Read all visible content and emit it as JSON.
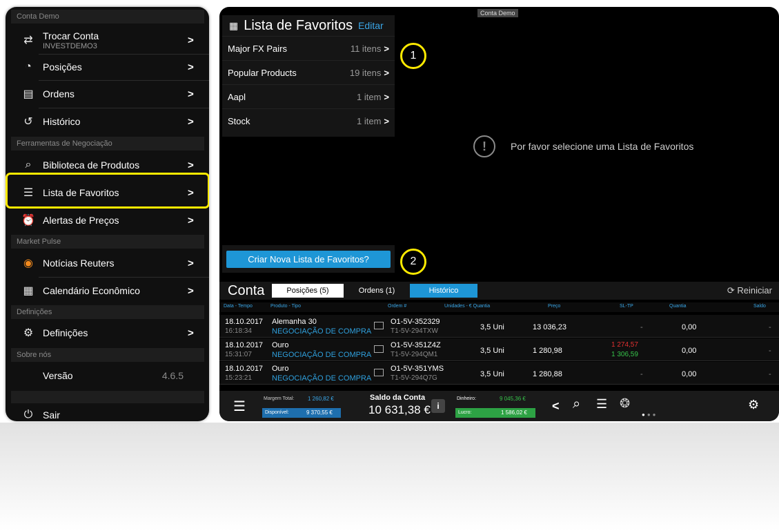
{
  "phone": {
    "sections": {
      "demo": "Conta Demo",
      "tools": "Ferramentas de Negociação",
      "pulse": "Market Pulse",
      "settings": "Definições",
      "about": "Sobre nós"
    },
    "items": {
      "switch_account": "Trocar Conta",
      "account_id": "INVESTDEMO3",
      "positions": "Posições",
      "orders": "Ordens",
      "history": "Histórico",
      "product_library": "Biblioteca de Produtos",
      "favorites": "Lista de Favoritos",
      "price_alerts": "Alertas de Preços",
      "reuters": "Notícias Reuters",
      "calendar": "Calendário Econômico",
      "settings": "Definições",
      "version": "Versão",
      "version_value": "4.6.5",
      "logout": "Sair"
    },
    "highlight_color": "#ffea00"
  },
  "tablet": {
    "demo_tag": "Conta Demo",
    "favorites": {
      "title": "Lista de Favoritos",
      "edit": "Editar",
      "lists": [
        {
          "name": "Major FX Pairs",
          "count": "11 itens"
        },
        {
          "name": "Popular Products",
          "count": "19 itens"
        },
        {
          "name": "Aapl",
          "count": "1 item"
        },
        {
          "name": "Stock",
          "count": "1 item"
        }
      ]
    },
    "callouts": [
      "1",
      "2"
    ],
    "empty_message": "Por favor selecione uma Lista de Favoritos",
    "create_button": "Criar Nova Lista de Favoritos?",
    "account": {
      "title": "Conta",
      "tabs": [
        "Posições (5)",
        "Ordens (1)",
        "Histórico"
      ],
      "reset": "Reiniciar",
      "columns": [
        "Data - Tempo",
        "Produto - Tipo",
        "Ordem #",
        "Unidades - € Quantia",
        "Preço",
        "SL-TP",
        "Quantia",
        "Saldo"
      ],
      "rows": [
        {
          "date": "18.10.2017",
          "time": "16:18:34",
          "product": "Alemanha 30",
          "type": "NEGOCIAÇÃO DE COMPRA",
          "order": "O1-5V-352329",
          "trade": "T1-5V-294TXW",
          "units": "3,5 Uni",
          "price": "13 036,23",
          "sl": "-",
          "tp": "",
          "amount": "0,00",
          "balance": "-"
        },
        {
          "date": "18.10.2017",
          "time": "15:31:07",
          "product": "Ouro",
          "type": "NEGOCIAÇÃO DE COMPRA",
          "order": "O1-5V-351Z4Z",
          "trade": "T1-5V-294QM1",
          "units": "3,5 Uni",
          "price": "1 280,98",
          "sl": "1 274,57",
          "tp": "1 306,59",
          "amount": "0,00",
          "balance": "-"
        },
        {
          "date": "18.10.2017",
          "time": "15:23:21",
          "product": "Ouro",
          "type": "NEGOCIAÇÃO DE COMPRA",
          "order": "O1-5V-351YMS",
          "trade": "T1-5V-294Q7G",
          "units": "3,5 Uni",
          "price": "1 280,88",
          "sl": "-",
          "tp": "",
          "amount": "0,00",
          "balance": "-"
        }
      ]
    },
    "bottom": {
      "margin_label": "Margem Total:",
      "margin_value": "1 260,82 €",
      "available_label": "Disponível:",
      "available_value": "9 370,55 €",
      "balance_label": "Saldo da Conta",
      "balance_value": "10 631,38 €",
      "cash_label": "Dinheiro:",
      "cash_value": "9 045,36 €",
      "profit_label": "Lucro:",
      "profit_value": "1 586,02 €"
    },
    "colors": {
      "accent": "#1e96d6",
      "profit": "#2da244",
      "loss": "#e23030",
      "highlight": "#ffea00"
    }
  }
}
